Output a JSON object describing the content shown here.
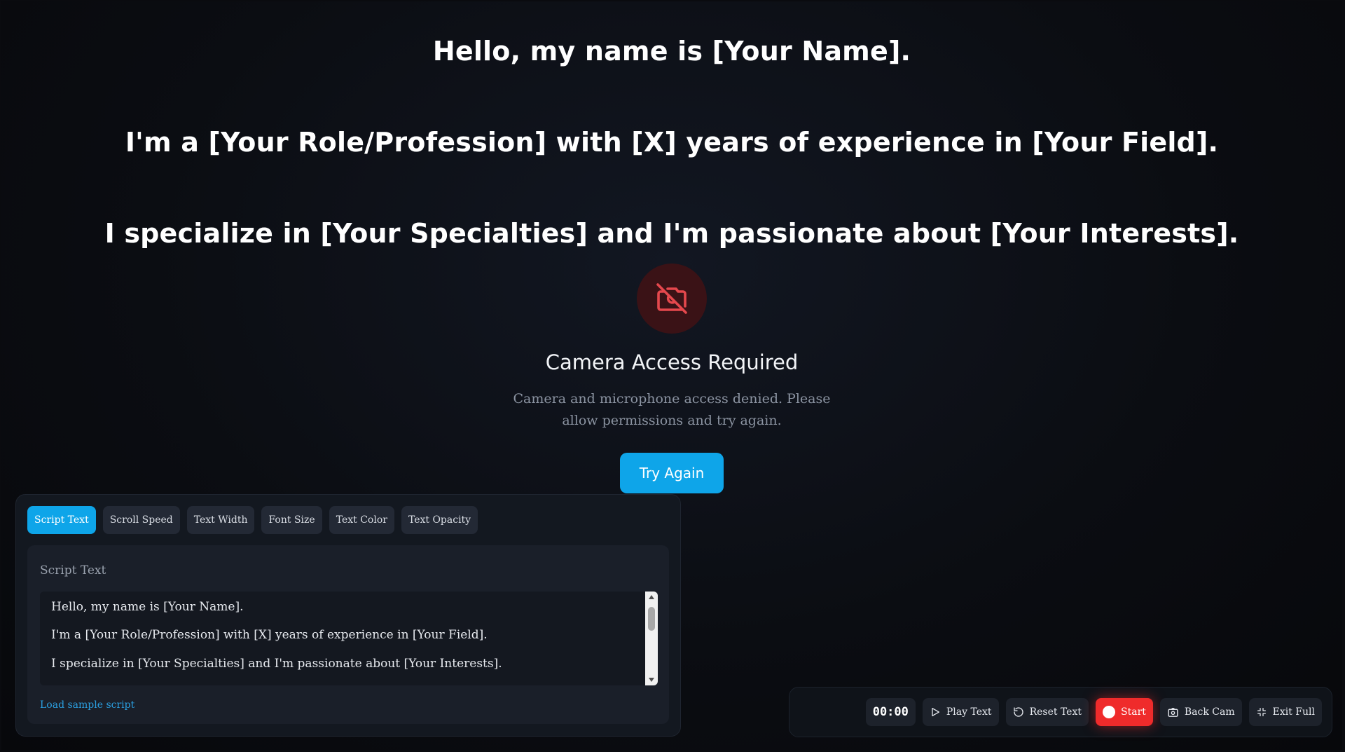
{
  "script_display": {
    "lines": [
      "Hello, my name is [Your Name].",
      "I'm a [Your Role/Profession] with [X] years of experience in [Your Field].",
      "I specialize in [Your Specialties] and I'm passionate about [Your Interests]."
    ]
  },
  "camera_notice": {
    "icon": "camera-off-icon",
    "title": "Camera Access Required",
    "message": "Camera and microphone access denied. Please allow permissions and try again.",
    "retry_label": "Try Again"
  },
  "settings_panel": {
    "tabs": [
      {
        "label": "Script Text",
        "active": true
      },
      {
        "label": "Scroll Speed",
        "active": false
      },
      {
        "label": "Text Width",
        "active": false
      },
      {
        "label": "Font Size",
        "active": false
      },
      {
        "label": "Text Color",
        "active": false
      },
      {
        "label": "Text Opacity",
        "active": false
      }
    ],
    "section_label": "Script Text",
    "script_lines": [
      "Hello, my name is [Your Name].",
      "I'm a [Your Role/Profession] with [X] years of experience in [Your Field].",
      "I specialize in [Your Specialties] and I'm passionate about [Your Interests]."
    ],
    "sample_link": "Load sample script"
  },
  "control_bar": {
    "timer": "00:00",
    "play_label": "Play Text",
    "reset_label": "Reset Text",
    "record_label": "Start",
    "camera_label": "Back Cam",
    "fullscreen_label": "Exit Full"
  },
  "colors": {
    "accent": "#0ea5e9",
    "record": "#ef2b2b",
    "camera_icon": "#e5484d"
  }
}
